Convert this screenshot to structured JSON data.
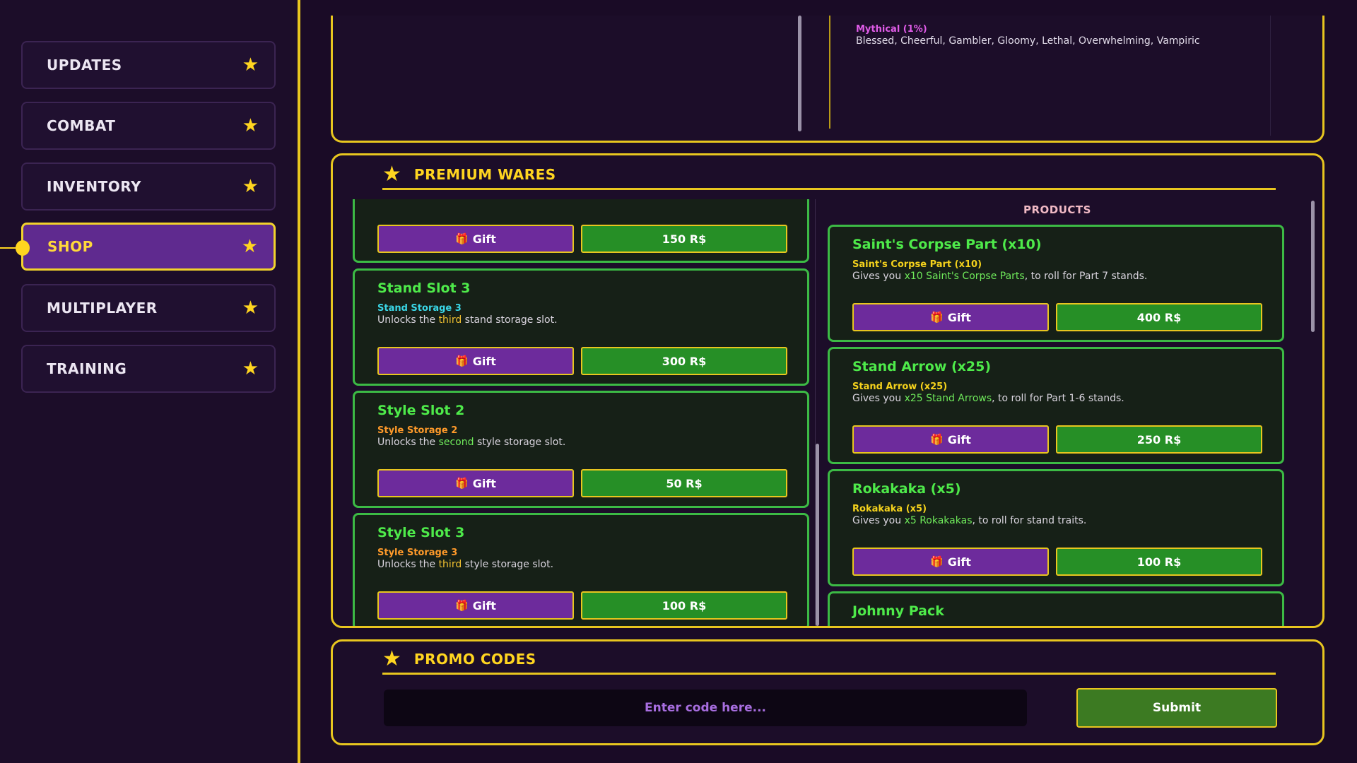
{
  "sidebar": {
    "items": [
      {
        "label": "UPDATES"
      },
      {
        "label": "COMBAT"
      },
      {
        "label": "INVENTORY"
      },
      {
        "label": "SHOP"
      },
      {
        "label": "MULTIPLAYER"
      },
      {
        "label": "TRAINING"
      }
    ],
    "active": "SHOP"
  },
  "top_panel": {
    "rarity_label": "Mythical (1%)",
    "rarity_traits": "Blessed, Cheerful, Gambler, Gloomy, Lethal, Overwhelming, Vampiric"
  },
  "premium": {
    "title": "PREMIUM WARES",
    "products_heading": "PRODUCTS",
    "gift_label": "Gift",
    "left_cards": [
      {
        "price": "150 R$"
      },
      {
        "title": "Stand Slot 3",
        "subtitle": "Stand Storage 3",
        "desc_pre": "Unlocks the ",
        "desc_hl": "third",
        "desc_post": " stand storage slot.",
        "price": "300 R$"
      },
      {
        "title": "Style Slot 2",
        "subtitle": "Style Storage 2",
        "desc_pre": "Unlocks the ",
        "desc_hl": "second",
        "desc_post": " style storage slot.",
        "price": "50 R$"
      },
      {
        "title": "Style Slot 3",
        "subtitle": "Style Storage 3",
        "desc_pre": "Unlocks the ",
        "desc_hl": "third",
        "desc_post": " style storage slot.",
        "price": "100 R$"
      }
    ],
    "right_cards": [
      {
        "title": "Saint's Corpse Part (x10)",
        "subtitle": "Saint's Corpse Part (x10)",
        "desc_pre": "Gives you ",
        "desc_hl": "x10 Saint's Corpse Parts",
        "desc_post": ", to roll for Part 7 stands.",
        "price": "400 R$"
      },
      {
        "title": "Stand Arrow (x25)",
        "subtitle": "Stand Arrow (x25)",
        "desc_pre": "Gives you ",
        "desc_hl": "x25 Stand Arrows",
        "desc_post": ", to roll for Part 1-6 stands.",
        "price": "250 R$"
      },
      {
        "title": "Rokakaka (x5)",
        "subtitle": "Rokakaka (x5)",
        "desc_pre": "Gives you ",
        "desc_hl": "x5 Rokakakas",
        "desc_post": ", to roll for stand traits.",
        "price": "100 R$"
      },
      {
        "title": "Johnny Pack"
      }
    ]
  },
  "promo": {
    "title": "PROMO CODES",
    "placeholder": "Enter code here...",
    "submit_label": "Submit"
  },
  "colors": {
    "accent_yellow": "#e8c61f",
    "card_green": "#3cba45",
    "gift_purple": "#6d2b9c",
    "price_green": "#268f26",
    "stand_subtitle_cyan": "#3ad6e6",
    "style_subtitle_orange": "#ff9a2a",
    "product_subtitle_yellow": "#f5d21c"
  },
  "icons": {
    "nav": "star-icon",
    "gift": "gift-icon"
  }
}
